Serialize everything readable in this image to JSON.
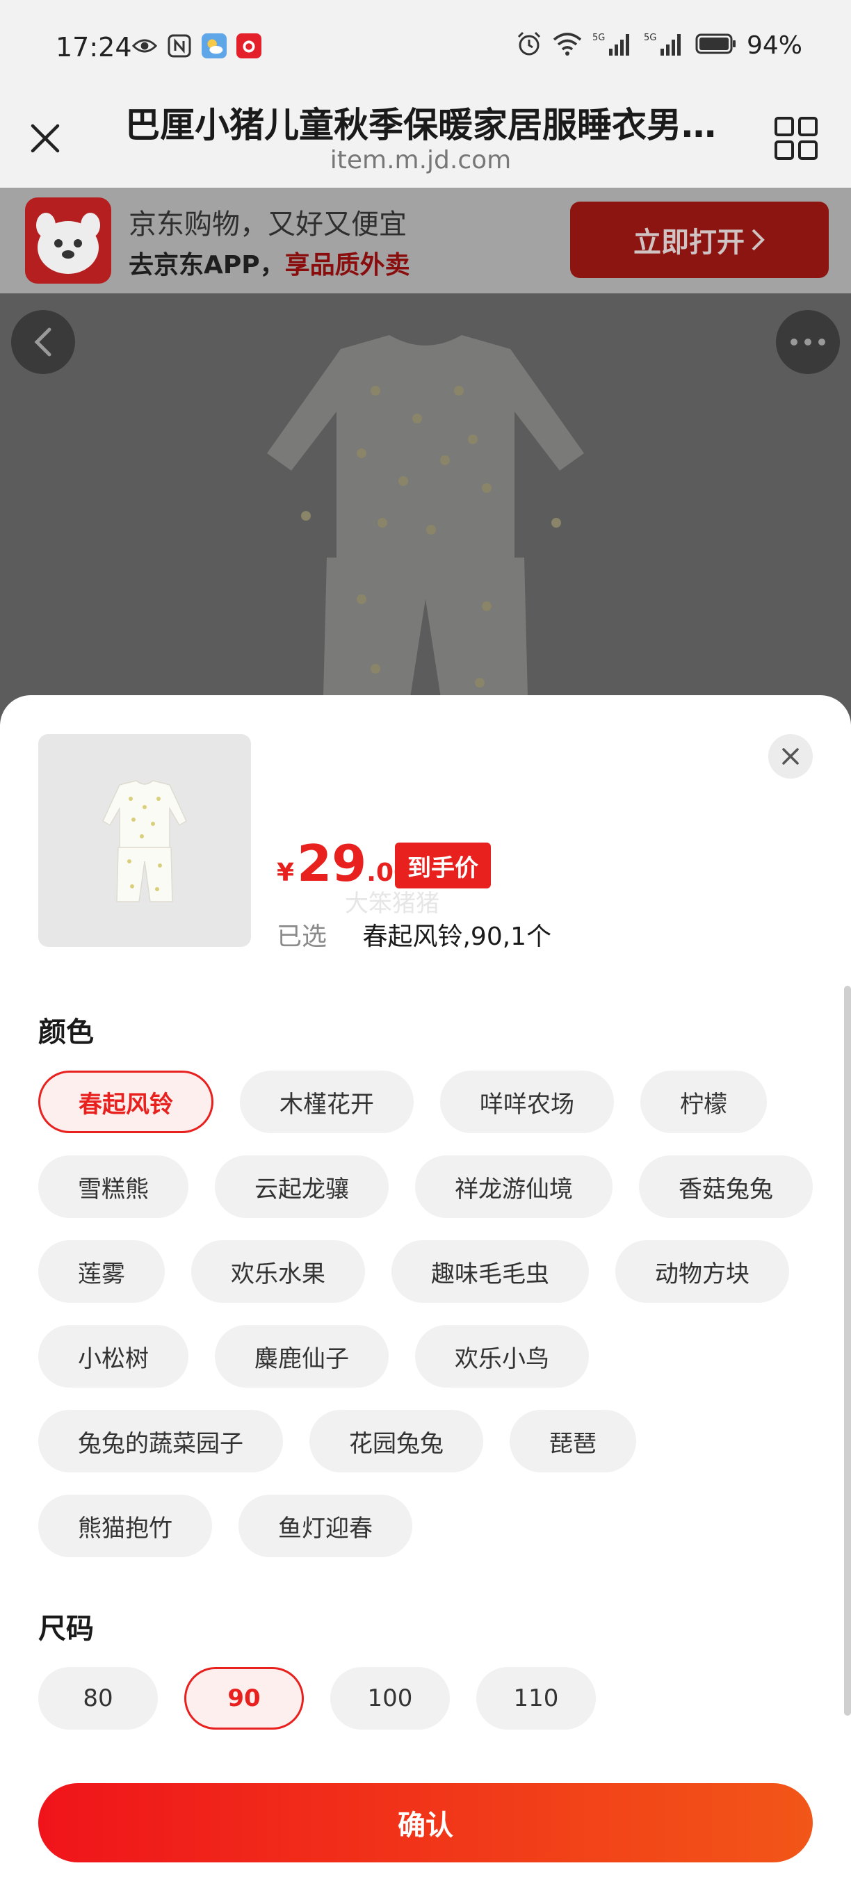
{
  "status_bar": {
    "time": "17:24",
    "battery_text": "94%",
    "icons": [
      "eye-icon",
      "nfc-icon",
      "weather-app-icon",
      "gift-app-icon",
      "alarm-icon",
      "wifi-icon",
      "signal-5g-icon",
      "signal-5g-icon",
      "battery-icon"
    ]
  },
  "header": {
    "title": "巴厘小猪儿童秋季保暖家居服睡衣男…",
    "url": "item.m.jd.com"
  },
  "banner": {
    "line1": "京东购物，又好又便宜",
    "line2_prefix": "去京东APP，",
    "line2_highlight": "享品质外卖",
    "open_button": "立即打开"
  },
  "sheet": {
    "price_currency": "¥",
    "price_integer": "29",
    "price_decimal": ".00",
    "price_badge": "到手价",
    "watermark": "大笨猪猪",
    "selected_label": "已选",
    "selected_value": "春起风铃,90,1个",
    "color_title": "颜色",
    "colors": [
      {
        "label": "春起风铃",
        "selected": true
      },
      {
        "label": "木槿花开",
        "selected": false
      },
      {
        "label": "咩咩农场",
        "selected": false
      },
      {
        "label": "柠檬",
        "selected": false
      },
      {
        "label": "雪糕熊",
        "selected": false
      },
      {
        "label": "云起龙骧",
        "selected": false
      },
      {
        "label": "祥龙游仙境",
        "selected": false
      },
      {
        "label": "香菇兔兔",
        "selected": false
      },
      {
        "label": "莲雾",
        "selected": false
      },
      {
        "label": "欢乐水果",
        "selected": false
      },
      {
        "label": "趣味毛毛虫",
        "selected": false
      },
      {
        "label": "动物方块",
        "selected": false
      },
      {
        "label": "小松树",
        "selected": false
      },
      {
        "label": "麋鹿仙子",
        "selected": false
      },
      {
        "label": "欢乐小鸟",
        "selected": false
      },
      {
        "label": "兔兔的蔬菜园子",
        "selected": false
      },
      {
        "label": "花园兔兔",
        "selected": false
      },
      {
        "label": "琵琶",
        "selected": false
      },
      {
        "label": "熊猫抱竹",
        "selected": false
      },
      {
        "label": "鱼灯迎春",
        "selected": false
      }
    ],
    "size_title": "尺码",
    "sizes": [
      {
        "label": "80",
        "selected": false
      },
      {
        "label": "90",
        "selected": true
      },
      {
        "label": "100",
        "selected": false
      },
      {
        "label": "110",
        "selected": false
      }
    ],
    "confirm_label": "确认"
  },
  "colors": {
    "accent": "#e8211f",
    "chip_bg": "#f1f1f1"
  }
}
